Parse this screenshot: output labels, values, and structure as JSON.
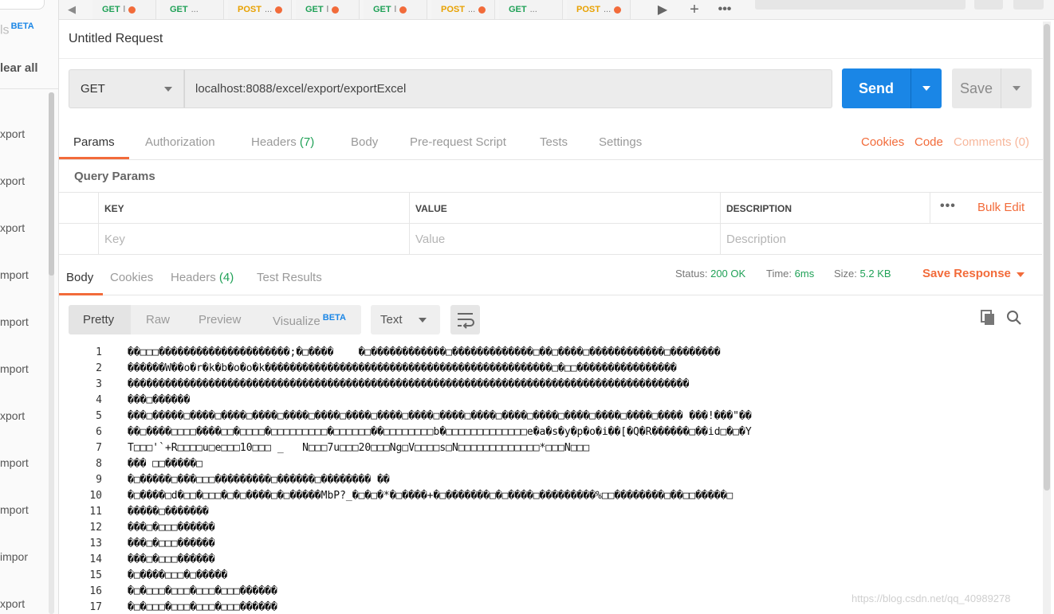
{
  "tabbar": {
    "tabs": [
      {
        "method": "GET",
        "name": "l",
        "dirty": true
      },
      {
        "method": "GET",
        "name": "...",
        "dirty": false
      },
      {
        "method": "POST",
        "name": "...",
        "dirty": true
      },
      {
        "method": "GET",
        "name": "l",
        "dirty": true
      },
      {
        "method": "GET",
        "name": "l",
        "dirty": true
      },
      {
        "method": "POST",
        "name": "...",
        "dirty": true
      },
      {
        "method": "GET",
        "name": "...",
        "dirty": false
      },
      {
        "method": "POST",
        "name": "...",
        "dirty": true
      }
    ],
    "more_icon": "ellipsis-icon",
    "add_icon": "plus-icon"
  },
  "sidebar": {
    "title": "ls",
    "beta": "BETA",
    "clear_all": "lear all",
    "items": [
      "xport",
      "xport",
      "xport",
      "mport",
      "mport",
      "mport",
      "xport",
      "mport",
      "mport",
      "impor",
      "xport"
    ]
  },
  "request": {
    "title": "Untitled Request",
    "method": "GET",
    "url": "localhost:8088/excel/export/exportExcel",
    "send_label": "Send",
    "save_label": "Save"
  },
  "request_tabs": {
    "items": [
      {
        "label": "Params",
        "count": ""
      },
      {
        "label": "Authorization",
        "count": ""
      },
      {
        "label": "Headers",
        "count": "(7)"
      },
      {
        "label": "Body",
        "count": ""
      },
      {
        "label": "Pre-request Script",
        "count": ""
      },
      {
        "label": "Tests",
        "count": ""
      },
      {
        "label": "Settings",
        "count": ""
      }
    ],
    "cookies": "Cookies",
    "code": "Code",
    "comments": "Comments (0)"
  },
  "params": {
    "section_title": "Query Params",
    "headers": [
      "KEY",
      "VALUE",
      "DESCRIPTION"
    ],
    "placeholders": [
      "Key",
      "Value",
      "Description"
    ],
    "bulk_edit": "Bulk Edit"
  },
  "response": {
    "tabs": [
      {
        "label": "Body",
        "count": ""
      },
      {
        "label": "Cookies",
        "count": ""
      },
      {
        "label": "Headers",
        "count": "(4)"
      },
      {
        "label": "Test Results",
        "count": ""
      }
    ],
    "status_label": "Status:",
    "status_value": "200 OK",
    "time_label": "Time:",
    "time_value": "6ms",
    "size_label": "Size:",
    "size_value": "5.2 KB",
    "save_response": "Save Response",
    "views": [
      "Pretty",
      "Raw",
      "Preview",
      "Visualize"
    ],
    "visualize_badge": "BETA",
    "format": "Text",
    "lines": [
      {
        "n": "1",
        "t": "��□□□���������������������;�□����    �□������������□�������������□��□����□������������□��������"
      },
      {
        "n": "2",
        "t": "������W��o�r�k�b�o�o�k����������������������������������������������□�□□����������������"
      },
      {
        "n": "3",
        "t": "������������������������������������������������������������������������������������������"
      },
      {
        "n": "4",
        "t": "���□������"
      },
      {
        "n": "5",
        "t": "���□�����□����□����□����□����□����□����□����□����□����□����□����□����□����□����□����□���� ���!���\"��"
      },
      {
        "n": "6",
        "t": "��□����□□□□����□□�□□□□�□□□□□□□□□�□□□□□□��□□□□□□□□b�□□□□□□□□□□□□□e�a�s�y�p�o�i��[�Q�R������□��id□�□�Y"
      },
      {
        "n": "7",
        "t": "T□□□'`+R□□□□u□e□□□10□□□ _   N□□□7u□□□20□□□Ng□V□□□□s□N□□□□□□□□□□□□□*□□□N□□□"
      },
      {
        "n": "8",
        "t": "��� □□�����□"
      },
      {
        "n": "9",
        "t": "�□�����□���□□□���������□������□�������� ��"
      },
      {
        "n": "10",
        "t": "�□����□d�□□�□□□�□�□����□�□�����MbP?_�□�□�*�□����+�□�������□�□����□���������%□□��������□��□□�����□"
      },
      {
        "n": "11",
        "t": "�����□�������"
      },
      {
        "n": "12",
        "t": "���□�□□□������"
      },
      {
        "n": "13",
        "t": "���□�□□□������"
      },
      {
        "n": "14",
        "t": "���□�□□□������"
      },
      {
        "n": "15",
        "t": "�□����□□□�□�����"
      },
      {
        "n": "16",
        "t": "�□�□□□�□□□�□□□�□□□������"
      },
      {
        "n": "17",
        "t": "�□�□□□�□□□�□□□�□□□������"
      }
    ]
  },
  "watermark": "https://blog.csdn.net/qq_40989278"
}
